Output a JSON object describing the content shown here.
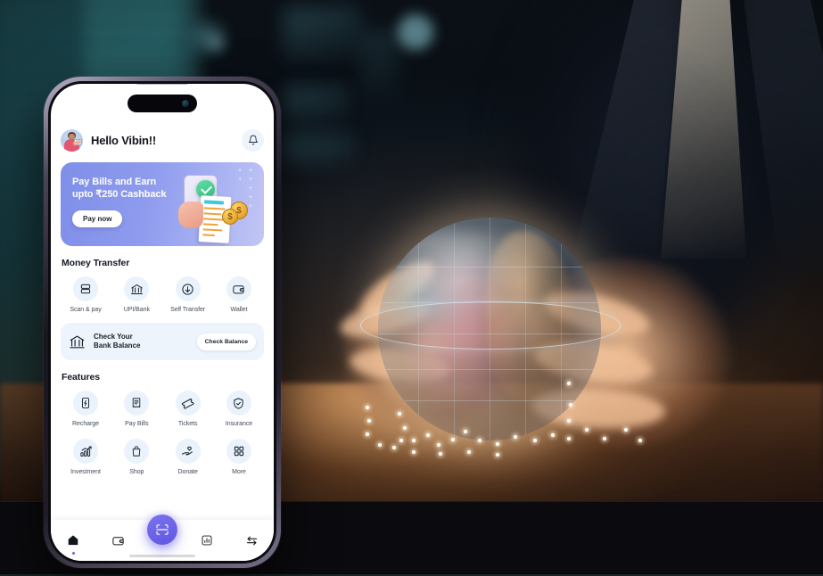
{
  "scene": {
    "description": "Dark office photograph: blurred person in a suit holding a glowing translucent holographic globe above a warmly lit desk, teal window blinds on the left",
    "colors": {
      "teal_glow": "#54d6d8",
      "desk_warm": "#ffba76",
      "background_dark": "#070a0e",
      "letterbox": "#0b0b0f"
    }
  },
  "phone": {
    "frame_color": "#17151d",
    "notch": "dynamic-island"
  },
  "app": {
    "header": {
      "avatar_name": "user-avatar",
      "greeting": "Hello Vibin!!",
      "notification_icon": "bell-icon"
    },
    "promo": {
      "line1": "Pay Bills and Earn",
      "line2": "upto ₹250 Cashback",
      "cta": "Pay now",
      "gradient_from": "#7f8ee8",
      "gradient_to": "#c3c7f5"
    },
    "money_transfer": {
      "title": "Money Transfer",
      "items": [
        {
          "label": "Scan & pay",
          "icon": "scan-pay-icon"
        },
        {
          "label": "UPI/Bank",
          "icon": "bank-icon"
        },
        {
          "label": "Self Transfer",
          "icon": "arrow-down-circle-icon"
        },
        {
          "label": "Wallet",
          "icon": "wallet-icon"
        }
      ]
    },
    "balance_card": {
      "line1": "Check Your",
      "line2": "Bank Balance",
      "button": "Check Balance",
      "icon": "bank-icon",
      "bg": "#eef4fc"
    },
    "features": {
      "title": "Features",
      "row1": [
        {
          "label": "Recharge",
          "icon": "mobile-recharge-icon"
        },
        {
          "label": "Pay Bills",
          "icon": "receipt-icon"
        },
        {
          "label": "Tickets",
          "icon": "ticket-icon"
        },
        {
          "label": "Insurance",
          "icon": "shield-check-icon"
        }
      ],
      "row2": [
        {
          "label": "Investment",
          "icon": "growth-chart-icon"
        },
        {
          "label": "Shop",
          "icon": "shopping-bag-icon"
        },
        {
          "label": "Donate",
          "icon": "donate-hand-icon"
        },
        {
          "label": "More",
          "icon": "grid-icon"
        }
      ]
    },
    "tabbar": {
      "active_color": "#6c63e8",
      "items": [
        {
          "name": "home",
          "icon": "home-icon",
          "active": true
        },
        {
          "name": "wallet",
          "icon": "wallet-icon",
          "active": false
        },
        {
          "name": "scan",
          "icon": "scan-frame-icon",
          "active": false
        },
        {
          "name": "stats",
          "icon": "bar-chart-icon",
          "active": false
        },
        {
          "name": "transfer",
          "icon": "transfer-arrows-icon",
          "active": false
        }
      ]
    }
  }
}
